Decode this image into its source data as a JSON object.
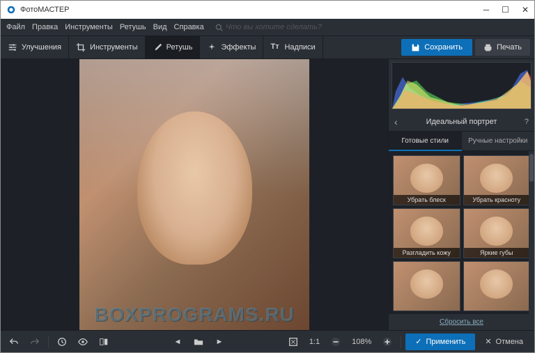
{
  "window": {
    "title": "ФотоМАСТЕР"
  },
  "menu": {
    "file": "Файл",
    "edit": "Правка",
    "tools": "Инструменты",
    "retouch": "Ретушь",
    "view": "Вид",
    "help": "Справка",
    "search_placeholder": "Что вы хотите сделать?"
  },
  "tabs": {
    "enhance": "Улучшения",
    "tools": "Инструменты",
    "retouch": "Ретушь",
    "effects": "Эффекты",
    "captions": "Надписи"
  },
  "actions": {
    "save": "Сохранить",
    "print": "Печать"
  },
  "panel": {
    "title": "Идеальный портрет",
    "subtab_presets": "Готовые стили",
    "subtab_manual": "Ручные настройки",
    "presets": [
      "Убрать блеск",
      "Убрать красноту",
      "Разгладить кожу",
      "Яркие губы",
      "",
      ""
    ],
    "reset": "Сбросить все"
  },
  "bottom": {
    "ratio": "1:1",
    "zoom": "108%",
    "apply": "Применить",
    "cancel": "Отмена"
  },
  "watermark": "BOXPROGRAMS.RU"
}
